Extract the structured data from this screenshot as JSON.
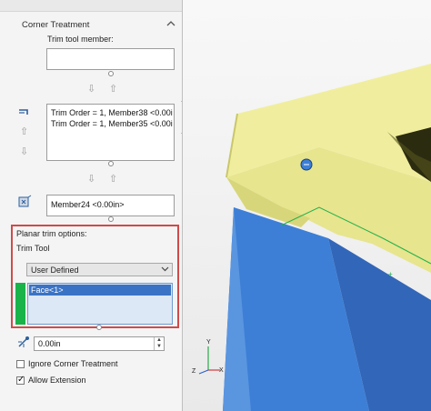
{
  "panel": {
    "section_title": "Corner Treatment",
    "trim_tool_member_label": "Trim tool member:",
    "trim_tool_member_value": "",
    "trim_list": [
      "Trim Order = 1, Member38   <0.00i",
      "Trim Order = 1, Member35   <0.00i"
    ],
    "member_value": "Member24   <0.00in>",
    "planar_trim_label": "Planar trim options:",
    "trim_tool_label": "Trim Tool",
    "trim_tool_select": "User Defined",
    "face_item": "Face<1>",
    "distance_value": "0.00in",
    "ignore_corner_label": "Ignore Corner Treatment",
    "ignore_corner_checked": false,
    "allow_extension_label": "Allow Extension",
    "allow_extension_checked": true
  },
  "triad": {
    "x": "X",
    "y": "Y",
    "z": "Z"
  },
  "colors": {
    "part_yellow": "#e7e58e",
    "leg_blue": "#3d7fd6",
    "highlight_red": "#d04a4a",
    "selection_green": "#19b34a"
  }
}
